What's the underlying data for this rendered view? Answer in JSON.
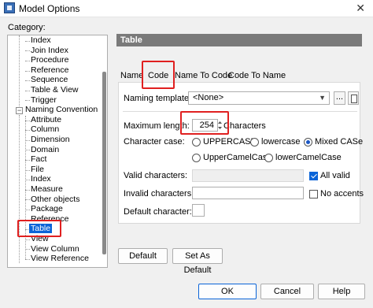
{
  "window": {
    "title": "Model Options"
  },
  "category_label": "Category:",
  "tree": {
    "items": [
      {
        "label": "Index"
      },
      {
        "label": "Join Index"
      },
      {
        "label": "Procedure"
      },
      {
        "label": "Reference"
      },
      {
        "label": "Sequence"
      },
      {
        "label": "Table & View"
      },
      {
        "label": "Trigger"
      },
      {
        "label": "Naming Convention"
      },
      {
        "label": "Attribute"
      },
      {
        "label": "Column"
      },
      {
        "label": "Dimension"
      },
      {
        "label": "Domain"
      },
      {
        "label": "Fact"
      },
      {
        "label": "File"
      },
      {
        "label": "Index"
      },
      {
        "label": "Measure"
      },
      {
        "label": "Other objects"
      },
      {
        "label": "Package"
      },
      {
        "label": "Reference"
      },
      {
        "label": "Table"
      },
      {
        "label": "View"
      },
      {
        "label": "View Column"
      },
      {
        "label": "View Reference"
      }
    ],
    "selected": "Table"
  },
  "panel": {
    "header": "Table",
    "tabs": [
      "Name",
      "Code",
      "Name To Code",
      "Code To Name"
    ],
    "active_tab": "Code",
    "naming_template": {
      "label": "Naming template:",
      "value": "<None>",
      "ellipsis": "..."
    },
    "max_length": {
      "label": "Maximum length:",
      "value": "254",
      "unit": "Characters"
    },
    "character_case": {
      "label": "Character case:",
      "options": [
        "UPPERCASE",
        "lowercase",
        "Mixed CASe",
        "UpperCamelCase",
        "lowerCamelCase"
      ],
      "selected": "Mixed CASe"
    },
    "valid_characters": {
      "label": "Valid characters:",
      "all_valid_label": "All valid",
      "all_valid_checked": true
    },
    "invalid_characters": {
      "label": "Invalid characters:",
      "no_accents_label": "No accents",
      "no_accents_checked": false
    },
    "default_character": {
      "label": "Default character:"
    },
    "default_button": "Default",
    "set_as_default_button": "Set As Default"
  },
  "footer": {
    "ok": "OK",
    "cancel": "Cancel",
    "help": "Help"
  },
  "colors": {
    "highlight": "#0a64d8",
    "annotation": "#e02020",
    "header_bg": "#7a7a7a"
  }
}
